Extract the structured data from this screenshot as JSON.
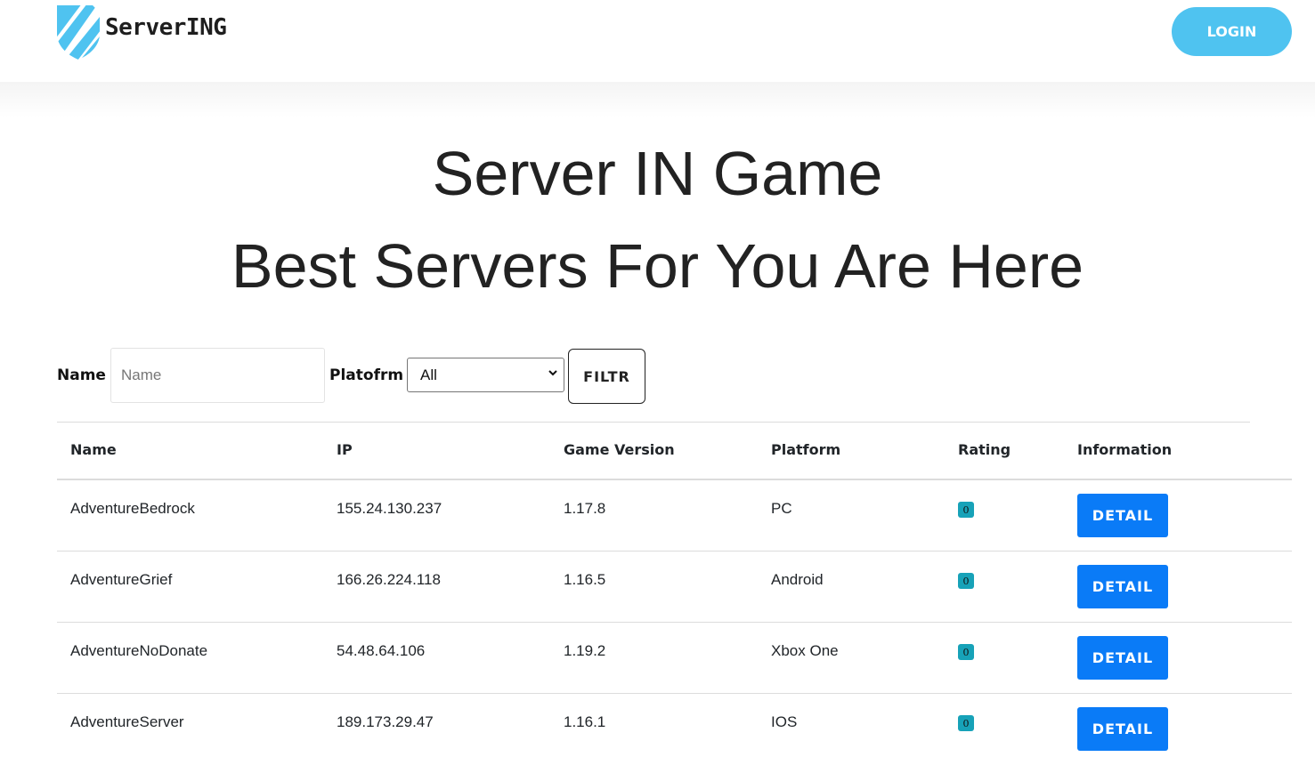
{
  "header": {
    "logo_text": "ServerING",
    "login_label": "LOGIN"
  },
  "hero": {
    "title": "Server IN Game",
    "subtitle": "Best Servers For You Are Here"
  },
  "filter": {
    "name_label": "Name",
    "name_placeholder": "Name",
    "platform_label": "Platofrm",
    "platform_selected": "All",
    "filter_button": "FILTR"
  },
  "table": {
    "headers": [
      "Name",
      "IP",
      "Game Version",
      "Platform",
      "Rating",
      "Information"
    ],
    "rows": [
      {
        "name": "AdventureBedrock",
        "ip": "155.24.130.237",
        "version": "1.17.8",
        "platform": "PC",
        "rating": "0",
        "action": "DETAIL"
      },
      {
        "name": "AdventureGrief",
        "ip": "166.26.224.118",
        "version": "1.16.5",
        "platform": "Android",
        "rating": "0",
        "action": "DETAIL"
      },
      {
        "name": "AdventureNoDonate",
        "ip": "54.48.64.106",
        "version": "1.19.2",
        "platform": "Xbox One",
        "rating": "0",
        "action": "DETAIL"
      },
      {
        "name": "AdventureServer",
        "ip": "189.173.29.47",
        "version": "1.16.1",
        "platform": "IOS",
        "rating": "0",
        "action": "DETAIL"
      }
    ]
  },
  "colors": {
    "login_bg": "#4fc3f0",
    "detail_bg": "#0a7bf7",
    "rating_badge": "#17a2b8",
    "logo_shield": "#4fc3f0"
  },
  "icons": {
    "logo": "shield-icon",
    "select": "chevron-down-icon"
  }
}
